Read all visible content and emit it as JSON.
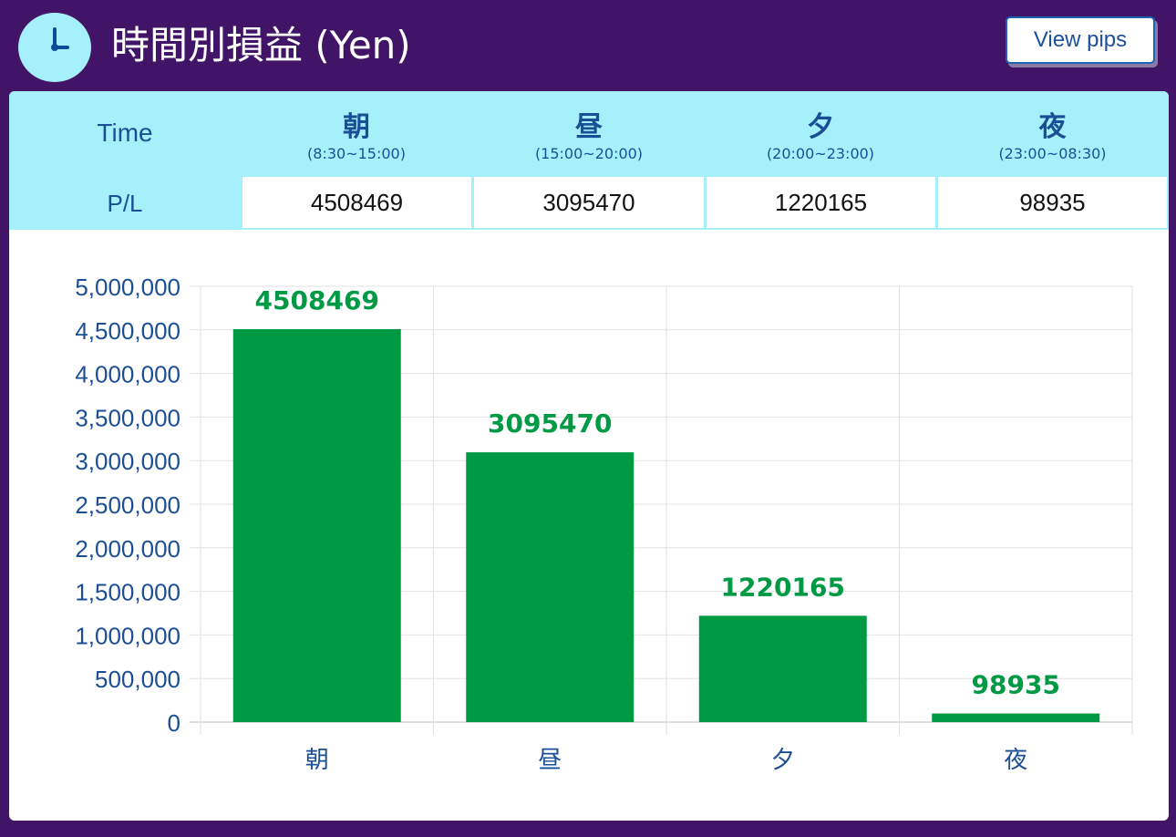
{
  "header": {
    "title": "時間別損益 (Yen)",
    "view_pips_label": "View pips",
    "icon": "clock-icon"
  },
  "table": {
    "row1_label": "Time",
    "row2_label": "P/L",
    "columns": [
      {
        "name": "朝",
        "range": "(8:30~15:00)",
        "pl": "4508469"
      },
      {
        "name": "昼",
        "range": "(15:00~20:00)",
        "pl": "3095470"
      },
      {
        "name": "夕",
        "range": "(20:00~23:00)",
        "pl": "1220165"
      },
      {
        "name": "夜",
        "range": "(23:00~08:30)",
        "pl": "98935"
      }
    ]
  },
  "colors": {
    "background": "#411467",
    "header_cell": "#a6f0fb",
    "bar": "#009944",
    "axis_text": "#1b4f95"
  },
  "chart_data": {
    "type": "bar",
    "categories": [
      "朝",
      "昼",
      "夕",
      "夜"
    ],
    "values": [
      4508469,
      3095470,
      1220165,
      98935
    ],
    "data_labels": [
      "4508469",
      "3095470",
      "1220165",
      "98935"
    ],
    "ylim": [
      0,
      5000000
    ],
    "ytick_step": 500000,
    "ytick_labels": [
      "0",
      "500,000",
      "1,000,000",
      "1,500,000",
      "2,000,000",
      "2,500,000",
      "3,000,000",
      "3,500,000",
      "4,000,000",
      "4,500,000",
      "5,000,000"
    ],
    "grid": true,
    "title": "",
    "xlabel": "",
    "ylabel": ""
  }
}
